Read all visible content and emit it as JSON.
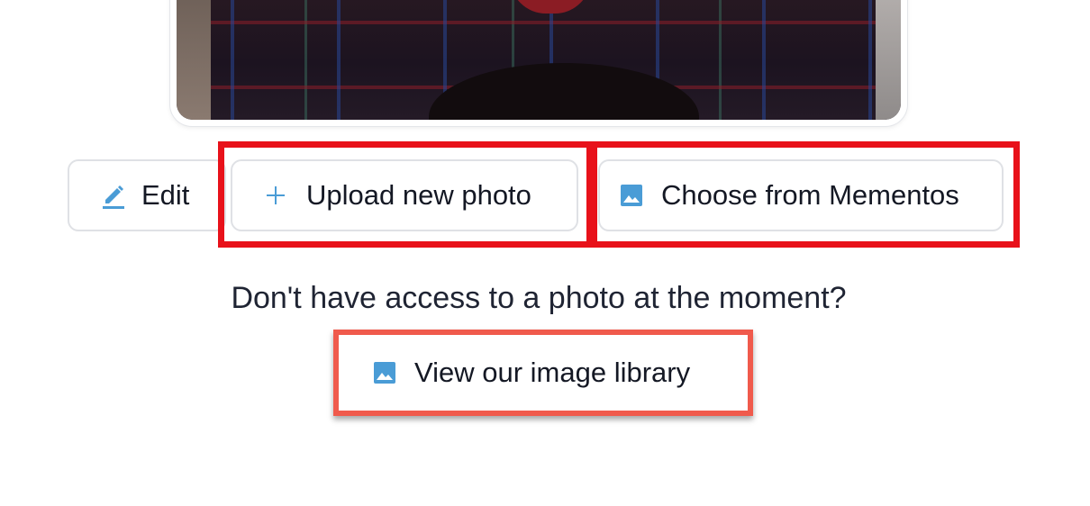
{
  "photo": {
    "alt": ""
  },
  "actions": {
    "edit": {
      "label": "Edit",
      "icon": "pencil-icon"
    },
    "upload": {
      "label": "Upload new photo",
      "icon": "plus-icon"
    },
    "mementos": {
      "label": "Choose from Mementos",
      "icon": "image-icon"
    }
  },
  "prompt": {
    "question": "Don't have access to a photo at the moment?"
  },
  "library": {
    "label": "View our image library",
    "icon": "image-icon"
  },
  "colors": {
    "accent": "#4a9cd6",
    "highlight_red": "#e8111a",
    "highlight_coral": "#f05a4c",
    "text": "#1f2433",
    "button_border": "#dfe1e5"
  }
}
